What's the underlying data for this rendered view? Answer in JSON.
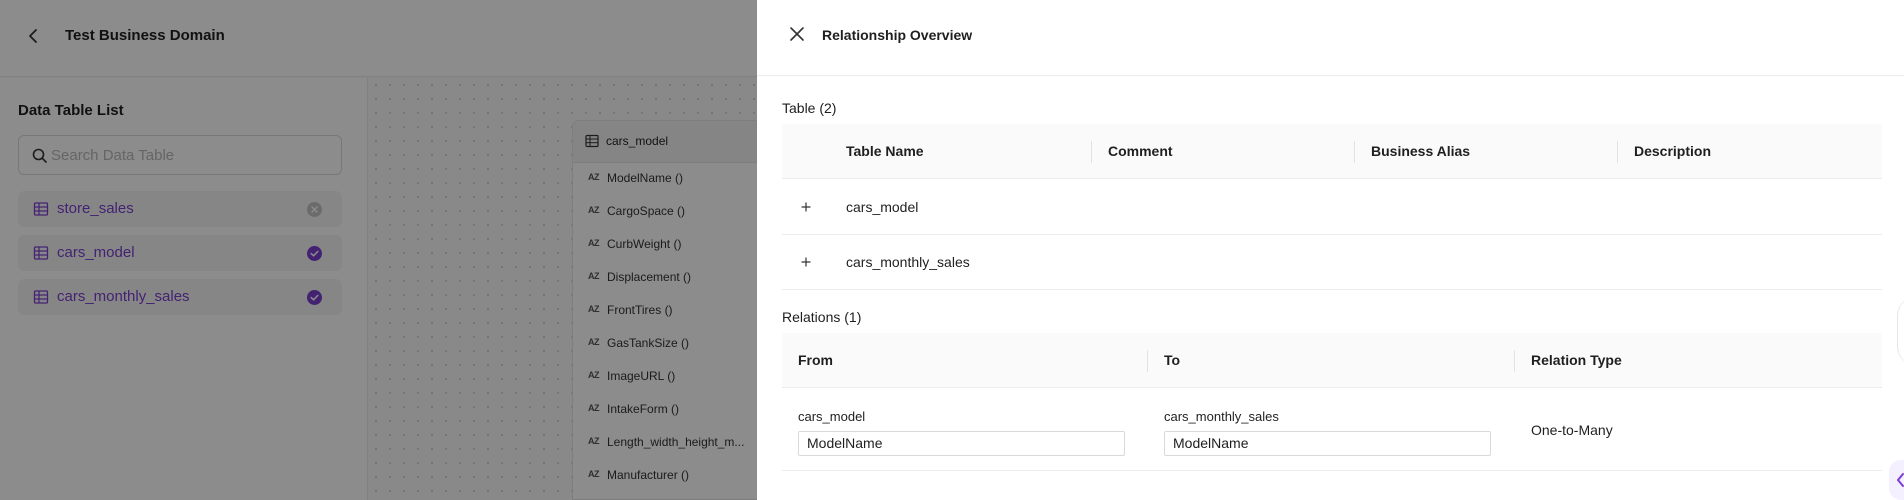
{
  "app": {
    "domain_title": "Test Business Domain"
  },
  "data_table_list": {
    "title": "Data Table List",
    "search_placeholder": "Search Data Table",
    "items": [
      {
        "label": "store_sales",
        "status": "unselected"
      },
      {
        "label": "cars_model",
        "status": "selected"
      },
      {
        "label": "cars_monthly_sales",
        "status": "selected"
      }
    ]
  },
  "canvas": {
    "table_card": {
      "name": "cars_model",
      "type_icon": "AZ",
      "columns": [
        "ModelName ()",
        "CargoSpace ()",
        "CurbWeight ()",
        "Displacement ()",
        "FrontTires ()",
        "GasTankSize ()",
        "ImageURL ()",
        "IntakeForm ()",
        "Length_width_height_m...",
        "Manufacturer ()"
      ]
    }
  },
  "drawer": {
    "title": "Relationship Overview",
    "tables_section": {
      "title": "Table (2)",
      "columns": [
        "Table Name",
        "Comment",
        "Business Alias",
        "Description"
      ],
      "rows": [
        {
          "table_name": "cars_model",
          "comment": "",
          "business_alias": "",
          "description": ""
        },
        {
          "table_name": "cars_monthly_sales",
          "comment": "",
          "business_alias": "",
          "description": ""
        }
      ]
    },
    "relations_section": {
      "title": "Relations (1)",
      "columns": [
        "From",
        "To",
        "Relation Type"
      ],
      "rows": [
        {
          "from_table": "cars_model",
          "from_field": "ModelName",
          "to_table": "cars_monthly_sales",
          "to_field": "ModelName",
          "relation_type": "One-to-Many"
        }
      ]
    }
  },
  "colors": {
    "accent": "#7a3fd0",
    "overlay": "rgba(0,0,0,0.45)"
  },
  "icons": {
    "back": "chevron-left-icon",
    "search": "search-icon",
    "table": "table-icon",
    "close": "close-icon",
    "expand": "plus-icon",
    "status_selected": "check-circle-icon",
    "status_unselected": "close-circle-icon",
    "side_tab": "chevron-left-icon"
  }
}
